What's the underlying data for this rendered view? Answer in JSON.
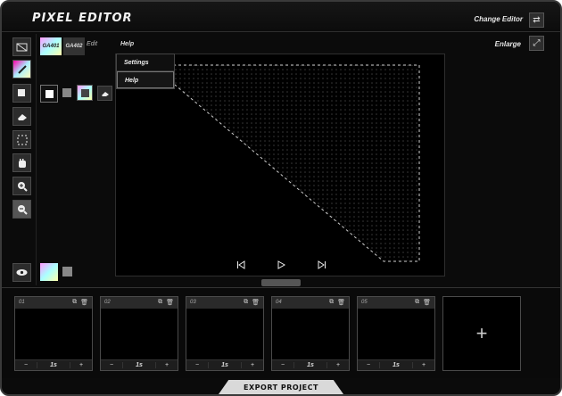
{
  "app": {
    "title": "PIXEL EDITOR",
    "change_editor_label": "Change Editor"
  },
  "colors": {
    "accent": "#cfcfcf",
    "background": "#0b0b0b"
  },
  "topbar": {
    "tiles": [
      {
        "label": "GA401"
      },
      {
        "label": "GA402"
      }
    ],
    "edit_label": "Edit",
    "help_label": "Help",
    "enlarge_label": "Enlarge"
  },
  "menu": {
    "items": [
      {
        "label": "Settings"
      },
      {
        "label": "Help"
      }
    ]
  },
  "toolbar": {
    "tools": [
      "layer-icon",
      "pen-icon",
      "shape-icon",
      "eraser-icon",
      "select-icon",
      "hand-icon",
      "zoom-in-icon",
      "zoom-out-icon"
    ],
    "view_tool": "eye-icon"
  },
  "playback": {
    "controls": [
      "skip-back-icon",
      "play-icon",
      "skip-forward-icon"
    ]
  },
  "frames": [
    {
      "number": "01",
      "duration": "1s"
    },
    {
      "number": "02",
      "duration": "1s"
    },
    {
      "number": "03",
      "duration": "1s"
    },
    {
      "number": "04",
      "duration": "1s"
    },
    {
      "number": "05",
      "duration": "1s"
    }
  ],
  "frame_controls": {
    "minus": "−",
    "plus": "+"
  },
  "add_frame_symbol": "+",
  "export_label": "EXPORT PROJECT"
}
